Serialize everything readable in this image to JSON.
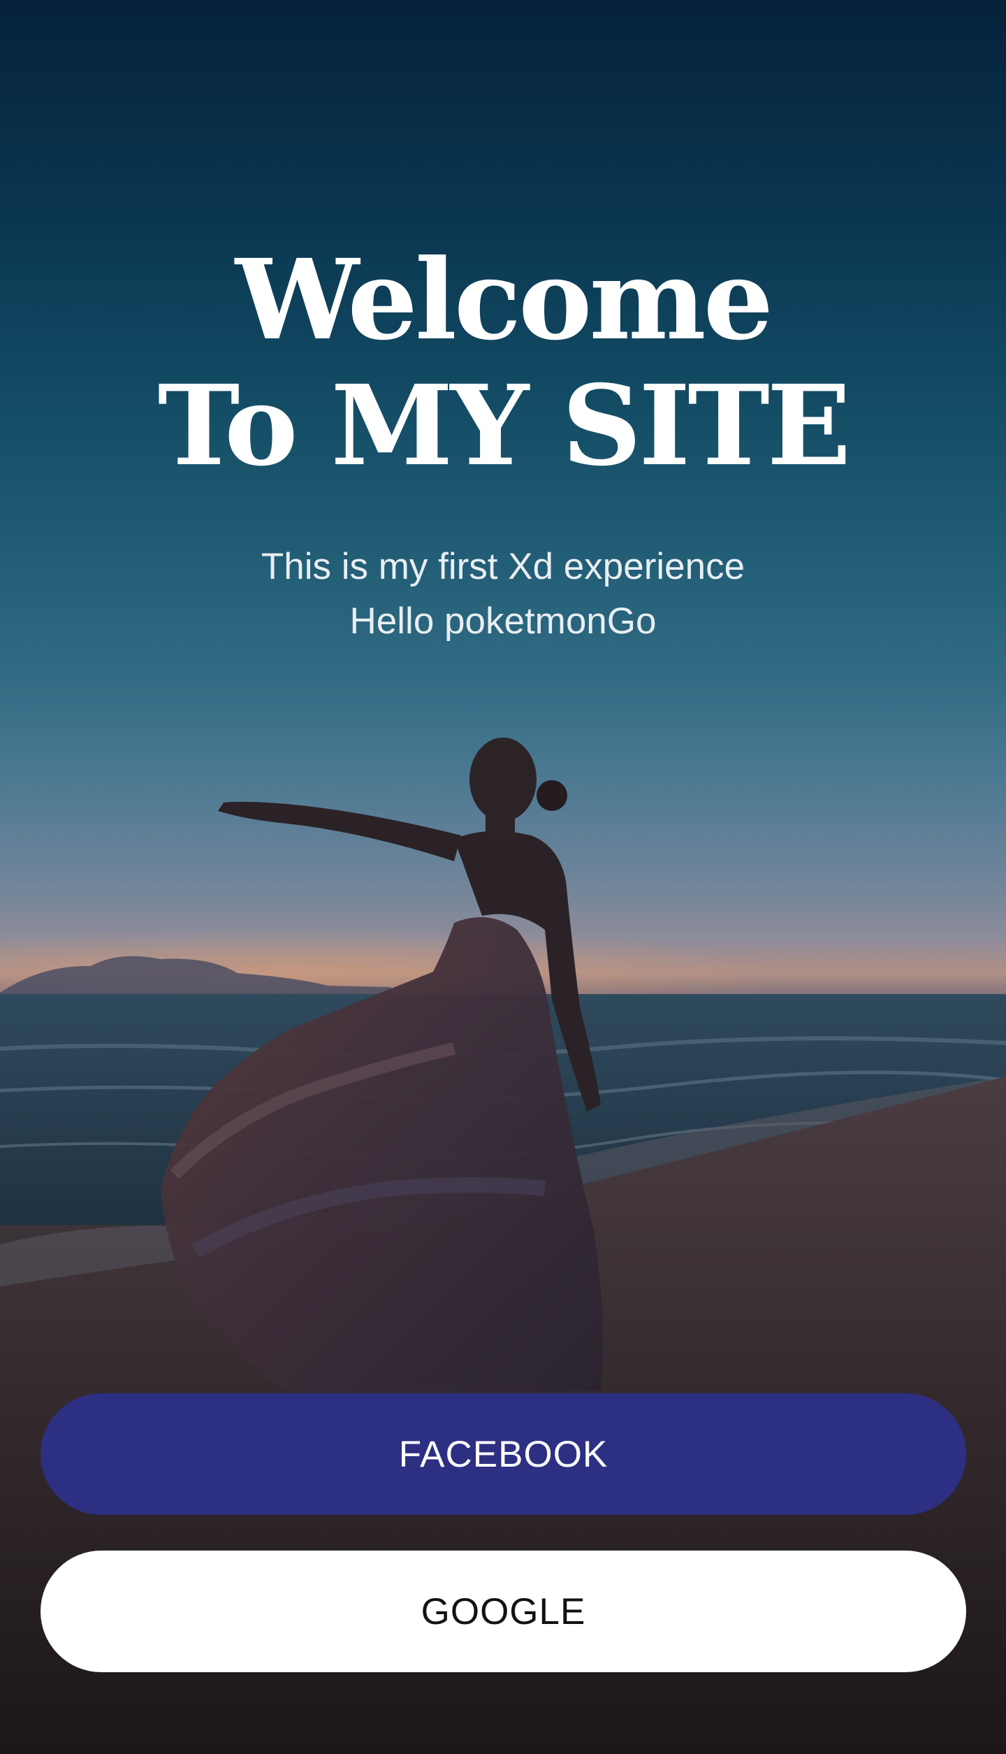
{
  "hero": {
    "title_line_1": "Welcome",
    "title_line_2": "To MY SITE",
    "subtitle_line_1": "This is my first Xd experience",
    "subtitle_line_2": "Hello poketmonGo"
  },
  "buttons": {
    "facebook_label": "FACEBOOK",
    "google_label": "GOOGLE"
  },
  "colors": {
    "facebook_button": "#2c2f82",
    "google_button": "#ffffff",
    "title_text": "#ffffff"
  }
}
